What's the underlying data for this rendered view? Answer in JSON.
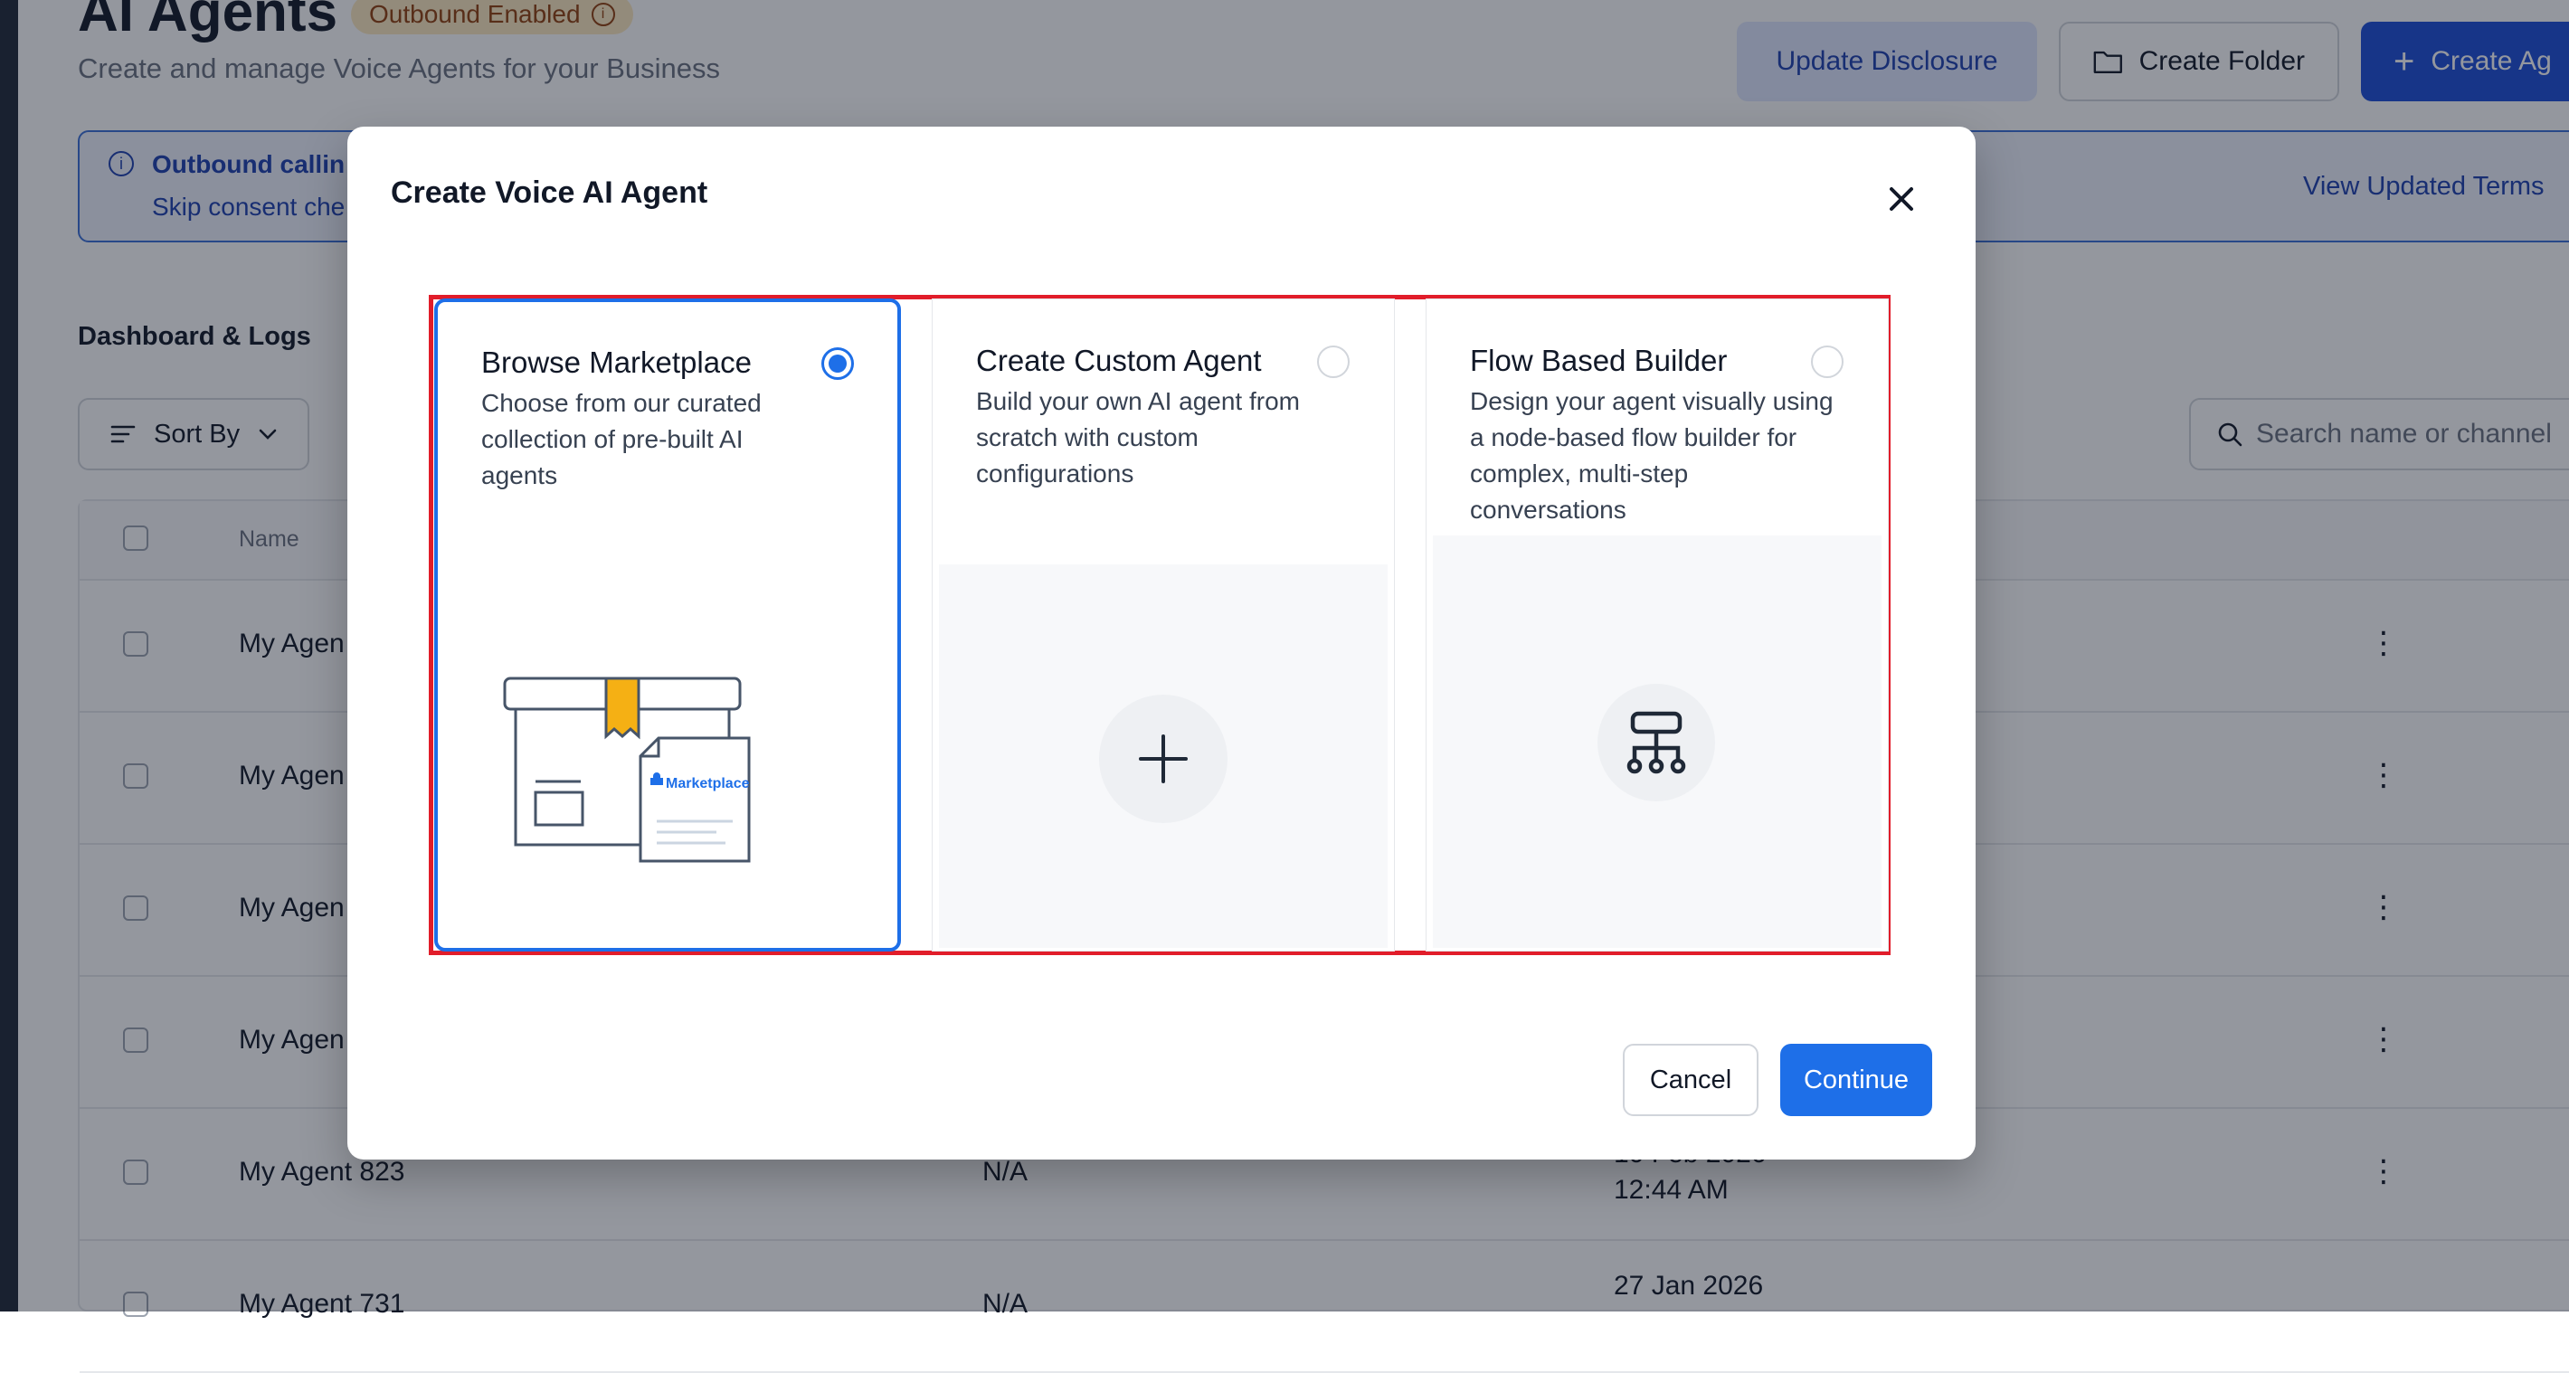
{
  "header": {
    "title": "AI Agents",
    "badge": "Outbound Enabled",
    "subtitle": "Create and manage Voice Agents for your Business",
    "update_disclosure": "Update Disclosure",
    "create_folder": "Create Folder",
    "create_agent": "Create Ag"
  },
  "banner": {
    "title": "Outbound callin",
    "description": "Skip consent che",
    "link": "View Updated Terms"
  },
  "section_title": "Dashboard & Logs",
  "toolbar": {
    "sort_label": "Sort By",
    "search_placeholder": "Search name or channel"
  },
  "table": {
    "columns": [
      "Name"
    ],
    "rows": [
      {
        "name": "My Agen",
        "col2": "",
        "date": "",
        "time": ""
      },
      {
        "name": "My Agen",
        "col2": "",
        "date": "",
        "time": ""
      },
      {
        "name": "My Agen",
        "col2": "",
        "date": "",
        "time": ""
      },
      {
        "name": "My Agen",
        "col2": "",
        "date": "",
        "time": ""
      },
      {
        "name": "My Agent 823",
        "col2": "N/A",
        "date": "10 Feb 2026",
        "time": "12:44 AM"
      },
      {
        "name": "My Agent 731",
        "col2": "N/A",
        "date": "27 Jan 2026",
        "time": ""
      }
    ]
  },
  "modal": {
    "title": "Create Voice AI Agent",
    "options": [
      {
        "title": "Browse Marketplace",
        "description": "Choose from our curated collection of pre-built AI agents",
        "selected": true,
        "illustration_label": "Marketplace"
      },
      {
        "title": "Create Custom Agent",
        "description": "Build your own AI agent from scratch with custom configurations",
        "selected": false
      },
      {
        "title": "Flow Based Builder",
        "description": "Design your agent visually using a node-based flow builder for complex, multi-step conversations",
        "selected": false
      }
    ],
    "cancel_label": "Cancel",
    "continue_label": "Continue"
  },
  "colors": {
    "primary": "#1e6fe8",
    "highlight": "#e11d2a",
    "badge_bg": "#fde9c0",
    "badge_text": "#92400e",
    "marketplace_tag": "#f5b014"
  }
}
